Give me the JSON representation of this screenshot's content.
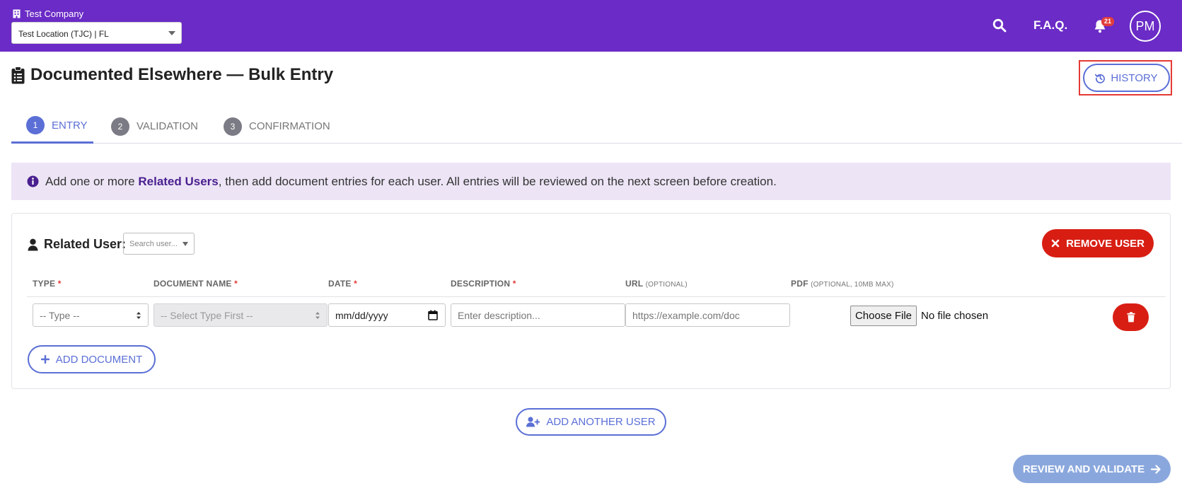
{
  "header": {
    "company": "Test Company",
    "location": "Test Location (TJC) | FL",
    "faq_label": "F.A.Q.",
    "notification_count": "21",
    "avatar_initials": "PM",
    "bar_color": "#6a2bc6"
  },
  "page": {
    "title": "Documented Elsewhere — Bulk Entry",
    "history_label": "HISTORY"
  },
  "steps": [
    {
      "num": "1",
      "label": "ENTRY",
      "active": true
    },
    {
      "num": "2",
      "label": "VALIDATION",
      "active": false
    },
    {
      "num": "3",
      "label": "CONFIRMATION",
      "active": false
    }
  ],
  "info": {
    "prefix": "Add one or more ",
    "bold": "Related Users",
    "suffix": ", then add document entries for each user. All entries will be reviewed on the next screen before creation."
  },
  "related_user": {
    "label": "Related User:",
    "search_placeholder": "Search user...",
    "remove_label": "REMOVE USER"
  },
  "columns": {
    "type": "TYPE",
    "document_name": "DOCUMENT NAME",
    "date": "DATE",
    "description": "DESCRIPTION",
    "url": "URL",
    "url_note": "(OPTIONAL)",
    "pdf": "PDF",
    "pdf_note": "(OPTIONAL, 10MB MAX)",
    "required_mark": "*"
  },
  "row": {
    "type_value": "-- Type --",
    "document_name_value": "-- Select Type First --",
    "date_placeholder": "mm/dd/yyyy",
    "description_placeholder": "Enter description...",
    "url_placeholder": "https://example.com/doc",
    "file_button": "Choose File",
    "file_status": "No file chosen"
  },
  "actions": {
    "add_document": "ADD DOCUMENT",
    "add_another_user": "ADD ANOTHER USER",
    "review_validate": "REVIEW AND VALIDATE"
  },
  "colors": {
    "accent": "#5b6fd6",
    "danger": "#d81e13",
    "info_bg": "#ede5f6"
  }
}
